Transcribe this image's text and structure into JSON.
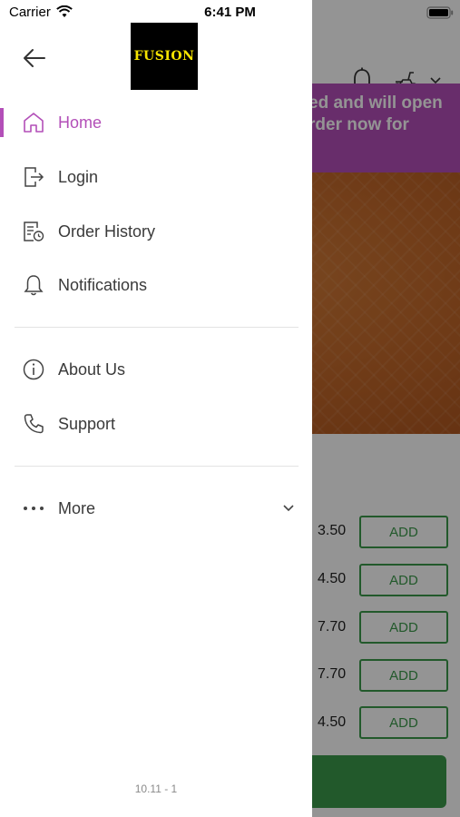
{
  "status_bar": {
    "carrier": "Carrier",
    "time": "6:41 PM"
  },
  "background": {
    "banner_text": "ed and will open\nrder now for",
    "items": [
      {
        "price": "3.50",
        "button": "ADD"
      },
      {
        "price": "4.50",
        "button": "ADD"
      },
      {
        "price": "7.70",
        "button": "ADD"
      },
      {
        "price": "7.70",
        "button": "ADD"
      },
      {
        "price": "4.50",
        "button": "ADD"
      }
    ]
  },
  "drawer": {
    "logo_text": "FUSION",
    "menu": [
      {
        "label": "Home",
        "icon": "home-icon",
        "active": true
      },
      {
        "label": "Login",
        "icon": "login-icon",
        "active": false
      },
      {
        "label": "Order History",
        "icon": "order-history-icon",
        "active": false
      },
      {
        "label": "Notifications",
        "icon": "bell-icon",
        "active": false
      },
      {
        "label": "About Us",
        "icon": "info-icon",
        "active": false
      },
      {
        "label": "Support",
        "icon": "phone-icon",
        "active": false
      },
      {
        "label": "More",
        "icon": "more-dots-icon",
        "active": false
      }
    ],
    "version": "10.11 - 1"
  },
  "colors": {
    "accent": "#b34fb8",
    "green": "#3b9a4a",
    "text": "#3a3a3a"
  }
}
